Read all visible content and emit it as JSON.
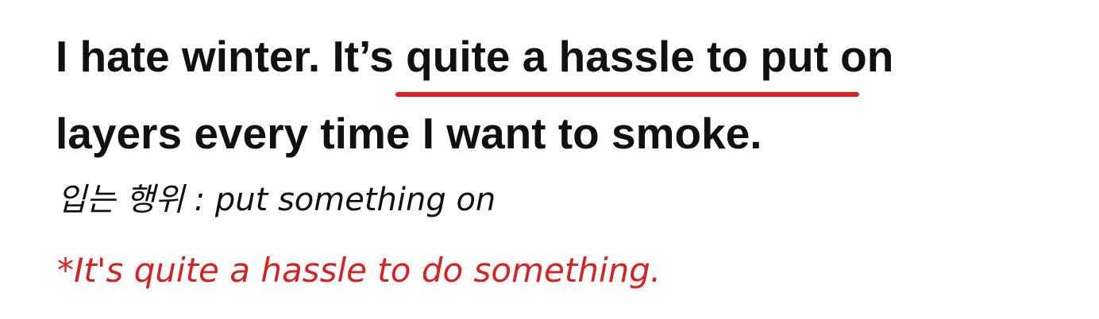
{
  "sentence": {
    "line1_before": "I hate winter. ",
    "line1_highlight": "It’s quite a hassle",
    "line1_after": " to put on",
    "line2": "layers every time I want to smoke."
  },
  "notes": {
    "note1": "입는 행위 : put something on",
    "note2": "*It's quite a hassle to do something."
  },
  "colors": {
    "text": "#111111",
    "accent_red": "#d62222"
  }
}
